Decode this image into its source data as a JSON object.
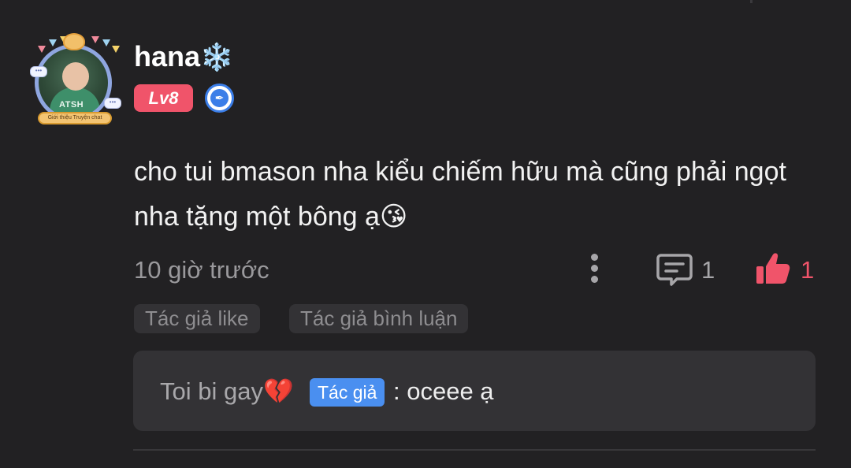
{
  "comment": {
    "username": "hana",
    "username_emoji": "❄️",
    "level_badge": "Lv8",
    "avatar_ribbon": "Giới thiệu Truyện chat",
    "text": "cho tui bmason nha kiểu chiếm hữu mà cũng phải ngọt nha tặng một bông ạ😘",
    "time": "10 giờ trước",
    "comment_count": "1",
    "like_count": "1",
    "tags": [
      "Tác giả like",
      "Tác giả bình luận"
    ]
  },
  "reply": {
    "author": "Toi bi gay💔",
    "author_tag": "Tác giả",
    "text": ": oceee ạ"
  },
  "colors": {
    "background": "#222123",
    "like_accent": "#f0546a",
    "author_tag": "#4a8ff0",
    "level_badge": "#f0546a"
  },
  "icons": {
    "more": "more-vertical-icon",
    "comment": "comment-icon",
    "like": "thumbs-up-icon",
    "badge": "pen-nib-icon"
  }
}
